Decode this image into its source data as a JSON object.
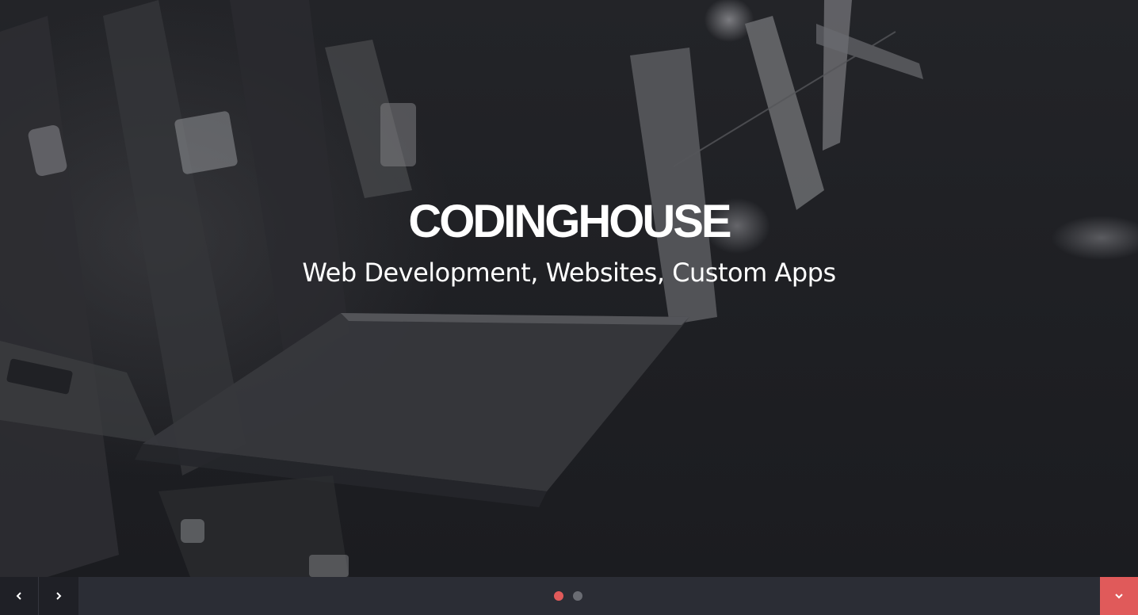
{
  "hero": {
    "title": "CODINGHOUSE",
    "subtitle": "Web Development, Websites, Custom Apps"
  },
  "slider": {
    "prev_icon": "chevron-left-icon",
    "next_icon": "chevron-right-icon",
    "dots": [
      {
        "active": true
      },
      {
        "active": false
      }
    ],
    "scroll_icon": "chevron-down-icon"
  },
  "colors": {
    "accent": "#e05a5a",
    "bar": "#2b2d35",
    "nav_button": "#1f2026",
    "dot_inactive": "#6a6c73",
    "hero_text": "#ffffff"
  }
}
